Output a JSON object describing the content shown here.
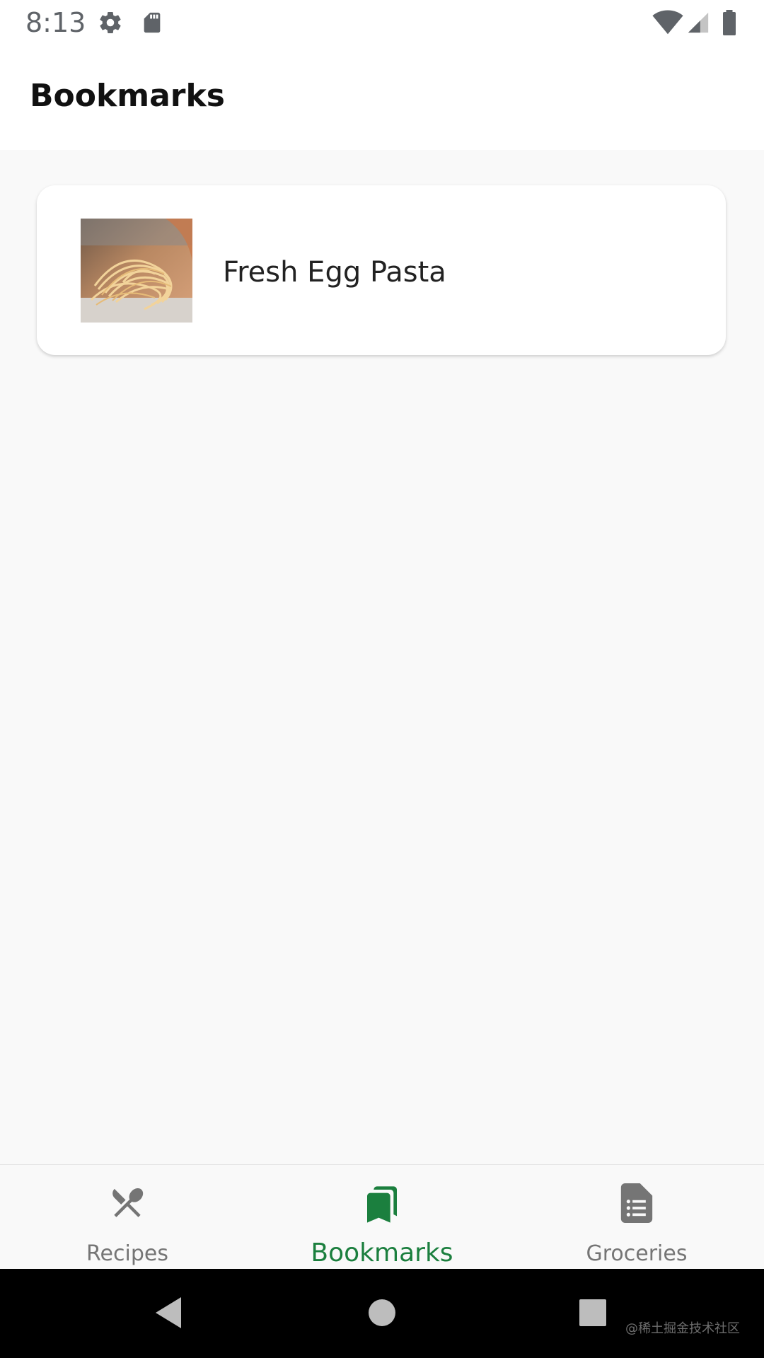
{
  "status_bar": {
    "time": "8:13",
    "icons": [
      "settings-icon",
      "sd-card-icon",
      "wifi-icon",
      "signal-icon",
      "battery-icon"
    ]
  },
  "app_bar": {
    "title": "Bookmarks"
  },
  "bookmarks": [
    {
      "title": "Fresh Egg Pasta",
      "thumbnail": "pasta-photo"
    }
  ],
  "bottom_nav": {
    "items": [
      {
        "label": "Recipes",
        "icon": "fork-knife-icon",
        "active": false
      },
      {
        "label": "Bookmarks",
        "icon": "bookmarks-icon",
        "active": true
      },
      {
        "label": "Groceries",
        "icon": "document-list-icon",
        "active": false
      }
    ]
  },
  "system_nav": {
    "watermark": "@稀土掘金技术社区"
  },
  "colors": {
    "accent": "#1b7f3e",
    "inactive": "#757575",
    "background": "#f9f9f9"
  }
}
